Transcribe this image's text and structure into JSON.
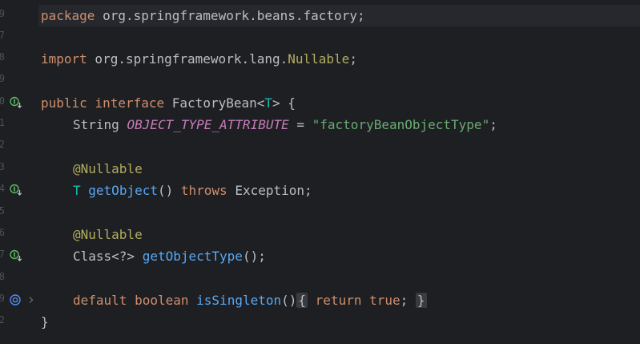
{
  "gutter": {
    "line_numbers": [
      "9",
      "7",
      "8",
      "9",
      "0",
      "1",
      "2",
      "3",
      "4",
      "5",
      "6",
      "7",
      "8",
      "9",
      "2"
    ]
  },
  "code": {
    "line1": {
      "kw": "package",
      "rest": " org.springframework.beans.factory;"
    },
    "line3": {
      "kw": "import",
      "rest_a": " org.springframework.lang.",
      "nullable": "Nullable",
      "semi": ";"
    },
    "line5": {
      "kw1": "public",
      "kw2": "interface",
      "name": "FactoryBean<",
      "tp": "T",
      "rest": "> {"
    },
    "line6": {
      "type": "String",
      "const": "OBJECT_TYPE_ATTRIBUTE",
      "eq": " = ",
      "str": "\"factoryBeanObjectType\"",
      "semi": ";"
    },
    "line8": {
      "ann": "@Nullable"
    },
    "line9": {
      "tp": "T",
      "fn": "getObject",
      "parens": "()",
      "kw": "throws",
      "rest": " Exception;"
    },
    "line11": {
      "ann": "@Nullable"
    },
    "line12": {
      "type": "Class<?>",
      "fn": "getObjectType",
      "rest": "();"
    },
    "line14": {
      "kw1": "default",
      "kw2": "boolean",
      "fn": "isSingleton",
      "parens": "()",
      "brace_open": "{",
      "kw3": "return",
      "kw4": "true",
      "semi": ";",
      "brace_close": "}"
    },
    "line15": {
      "brace": "}"
    }
  },
  "icons": {
    "implemented": "implemented-method-icon",
    "override": "overridden-method-icon",
    "fold": "fold-chevron-icon"
  },
  "colors": {
    "background": "#1e1f22",
    "keyword": "#cf8e6d",
    "function": "#56a8f5",
    "string": "#6aab73",
    "constant": "#c77dbb",
    "annotation": "#b3ae60",
    "type_param": "#16baac"
  }
}
